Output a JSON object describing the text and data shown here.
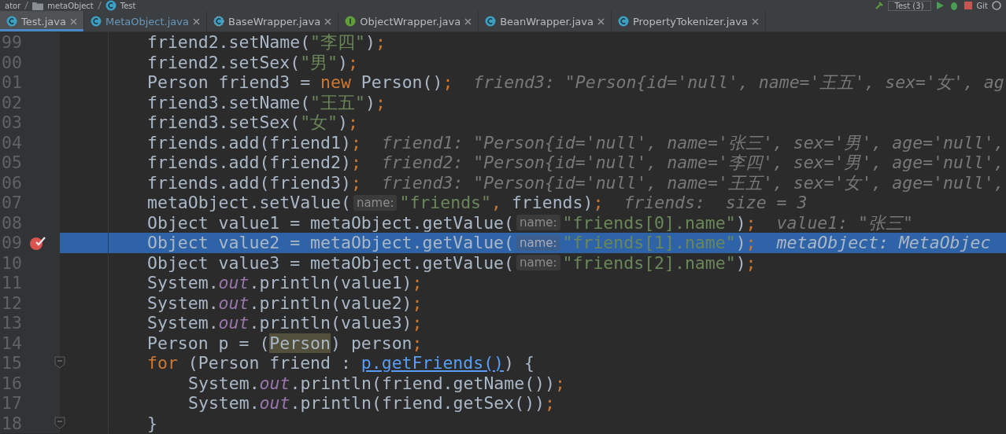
{
  "navbar": {
    "breadcrumbs": [
      {
        "label": "ator",
        "kind": "text"
      },
      {
        "label": "metaObject",
        "kind": "folder"
      },
      {
        "label": "Test",
        "kind": "class"
      }
    ],
    "run_config": "Test (3)",
    "vcs_label": "Git"
  },
  "tabs": [
    {
      "label": "Test.java",
      "kind": "class",
      "selected": true,
      "modified": false
    },
    {
      "label": "MetaObject.java",
      "kind": "class",
      "selected": false,
      "modified": true
    },
    {
      "label": "BaseWrapper.java",
      "kind": "abstract",
      "selected": false,
      "modified": false
    },
    {
      "label": "ObjectWrapper.java",
      "kind": "interface",
      "selected": false,
      "modified": false
    },
    {
      "label": "BeanWrapper.java",
      "kind": "class",
      "selected": false,
      "modified": false
    },
    {
      "label": "PropertyTokenizer.java",
      "kind": "class",
      "selected": false,
      "modified": false
    }
  ],
  "editor": {
    "lines": [
      {
        "number": "99",
        "breakpoint": false,
        "current": false,
        "fold": false,
        "tokens": [
          {
            "kind": "code",
            "text": "friend2.setName("
          },
          {
            "kind": "string",
            "text": "\"李四\""
          },
          {
            "kind": "code",
            "text": ")"
          },
          {
            "kind": "punct",
            "text": ";"
          }
        ]
      },
      {
        "number": "00",
        "breakpoint": false,
        "current": false,
        "fold": false,
        "tokens": [
          {
            "kind": "code",
            "text": "friend2.setSex("
          },
          {
            "kind": "string",
            "text": "\"男\""
          },
          {
            "kind": "code",
            "text": ")"
          },
          {
            "kind": "punct",
            "text": ";"
          }
        ]
      },
      {
        "number": "01",
        "breakpoint": false,
        "current": false,
        "fold": false,
        "tokens": [
          {
            "kind": "code",
            "text": "Person friend3 = "
          },
          {
            "kind": "keyword",
            "text": "new"
          },
          {
            "kind": "code",
            "text": " Person()"
          },
          {
            "kind": "punct",
            "text": ";"
          },
          {
            "kind": "inline",
            "text": "friend3: \"Person{id='null', name='王五', sex='女', ag"
          }
        ]
      },
      {
        "number": "02",
        "breakpoint": false,
        "current": false,
        "fold": false,
        "tokens": [
          {
            "kind": "code",
            "text": "friend3.setName("
          },
          {
            "kind": "string",
            "text": "\"王五\""
          },
          {
            "kind": "code",
            "text": ")"
          },
          {
            "kind": "punct",
            "text": ";"
          }
        ]
      },
      {
        "number": "03",
        "breakpoint": false,
        "current": false,
        "fold": false,
        "tokens": [
          {
            "kind": "code",
            "text": "friend3.setSex("
          },
          {
            "kind": "string",
            "text": "\"女\""
          },
          {
            "kind": "code",
            "text": ")"
          },
          {
            "kind": "punct",
            "text": ";"
          }
        ]
      },
      {
        "number": "04",
        "breakpoint": false,
        "current": false,
        "fold": false,
        "tokens": [
          {
            "kind": "code",
            "text": "friends.add(friend1)"
          },
          {
            "kind": "punct",
            "text": ";"
          },
          {
            "kind": "inline",
            "text": "friend1: \"Person{id='null', name='张三', sex='男', age='null',"
          }
        ]
      },
      {
        "number": "05",
        "breakpoint": false,
        "current": false,
        "fold": false,
        "tokens": [
          {
            "kind": "code",
            "text": "friends.add(friend2)"
          },
          {
            "kind": "punct",
            "text": ";"
          },
          {
            "kind": "inline",
            "text": "friend2: \"Person{id='null', name='李四', sex='男', age='null',"
          }
        ]
      },
      {
        "number": "06",
        "breakpoint": false,
        "current": false,
        "fold": false,
        "tokens": [
          {
            "kind": "code",
            "text": "friends.add(friend3)"
          },
          {
            "kind": "punct",
            "text": ";"
          },
          {
            "kind": "inline",
            "text": "friend3: \"Person{id='null', name='王五', sex='女', age='null',"
          }
        ]
      },
      {
        "number": "07",
        "breakpoint": false,
        "current": false,
        "fold": false,
        "tokens": [
          {
            "kind": "code",
            "text": "metaObject.setValue("
          },
          {
            "kind": "hint",
            "text": "name:"
          },
          {
            "kind": "string",
            "text": "\"friends\""
          },
          {
            "kind": "punct",
            "text": ","
          },
          {
            "kind": "code",
            "text": " friends)"
          },
          {
            "kind": "punct",
            "text": ";"
          },
          {
            "kind": "inline",
            "text": "friends:  size = 3"
          }
        ]
      },
      {
        "number": "08",
        "breakpoint": false,
        "current": false,
        "fold": false,
        "tokens": [
          {
            "kind": "code",
            "text": "Object value1 = metaObject.getValue("
          },
          {
            "kind": "hint",
            "text": "name:"
          },
          {
            "kind": "string",
            "text": "\"friends[0].name\""
          },
          {
            "kind": "code",
            "text": ")"
          },
          {
            "kind": "punct",
            "text": ";"
          },
          {
            "kind": "inline",
            "text": "value1: \"张三\""
          }
        ]
      },
      {
        "number": "09",
        "breakpoint": true,
        "current": true,
        "fold": false,
        "tokens": [
          {
            "kind": "code",
            "text": "Object value2 = metaObject.getValue("
          },
          {
            "kind": "hint",
            "text": "name:"
          },
          {
            "kind": "string",
            "text": "\"friends[1].name\""
          },
          {
            "kind": "code",
            "text": ")"
          },
          {
            "kind": "punct",
            "text": ";"
          },
          {
            "kind": "inline",
            "text": "metaObject: MetaObjec"
          }
        ]
      },
      {
        "number": "10",
        "breakpoint": false,
        "current": false,
        "fold": false,
        "tokens": [
          {
            "kind": "code",
            "text": "Object value3 = metaObject.getValue("
          },
          {
            "kind": "hint",
            "text": "name:"
          },
          {
            "kind": "string",
            "text": "\"friends[2].name\""
          },
          {
            "kind": "code",
            "text": ")"
          },
          {
            "kind": "punct",
            "text": ";"
          }
        ]
      },
      {
        "number": "11",
        "breakpoint": false,
        "current": false,
        "fold": false,
        "tokens": [
          {
            "kind": "code",
            "text": "System."
          },
          {
            "kind": "static",
            "text": "out"
          },
          {
            "kind": "code",
            "text": ".println(value1)"
          },
          {
            "kind": "punct",
            "text": ";"
          }
        ]
      },
      {
        "number": "12",
        "breakpoint": false,
        "current": false,
        "fold": false,
        "tokens": [
          {
            "kind": "code",
            "text": "System."
          },
          {
            "kind": "static",
            "text": "out"
          },
          {
            "kind": "code",
            "text": ".println(value2)"
          },
          {
            "kind": "punct",
            "text": ";"
          }
        ]
      },
      {
        "number": "13",
        "breakpoint": false,
        "current": false,
        "fold": false,
        "tokens": [
          {
            "kind": "code",
            "text": "System."
          },
          {
            "kind": "static",
            "text": "out"
          },
          {
            "kind": "code",
            "text": ".println(value3)"
          },
          {
            "kind": "punct",
            "text": ";"
          }
        ]
      },
      {
        "number": "14",
        "breakpoint": false,
        "current": false,
        "fold": false,
        "tokens": [
          {
            "kind": "code",
            "text": "Person p = ("
          },
          {
            "kind": "usage",
            "text": "Person"
          },
          {
            "kind": "code",
            "text": ") person"
          },
          {
            "kind": "punct",
            "text": ";"
          }
        ]
      },
      {
        "number": "15",
        "breakpoint": false,
        "current": false,
        "fold": true,
        "tokens": [
          {
            "kind": "keyword",
            "text": "for"
          },
          {
            "kind": "code",
            "text": " (Person friend : "
          },
          {
            "kind": "link",
            "text": "p.getFriends()"
          },
          {
            "kind": "code",
            "text": ") {"
          }
        ],
        "children": [
          {
            "number": "16",
            "breakpoint": false,
            "current": false,
            "fold": false,
            "tokens": [
              {
                "kind": "code",
                "text": "System."
              },
              {
                "kind": "static",
                "text": "out"
              },
              {
                "kind": "code",
                "text": ".println(friend.getName())"
              },
              {
                "kind": "punct",
                "text": ";"
              }
            ]
          },
          {
            "number": "17",
            "breakpoint": false,
            "current": false,
            "fold": false,
            "tokens": [
              {
                "kind": "code",
                "text": "System."
              },
              {
                "kind": "static",
                "text": "out"
              },
              {
                "kind": "code",
                "text": ".println(friend.getSex())"
              },
              {
                "kind": "punct",
                "text": ";"
              }
            ]
          }
        ]
      },
      {
        "number": "18",
        "breakpoint": false,
        "current": false,
        "fold": true,
        "tokens": [
          {
            "kind": "code",
            "text": "}"
          }
        ]
      }
    ]
  }
}
